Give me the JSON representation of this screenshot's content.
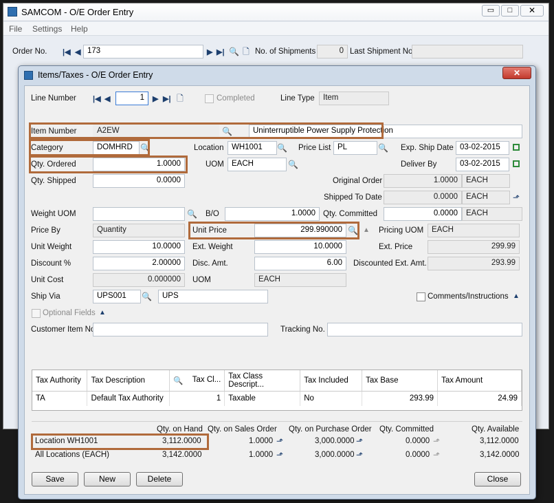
{
  "bg_window": {
    "title": "SAMCOM - O/E Order Entry",
    "menu": [
      "File",
      "Settings",
      "Help"
    ],
    "order_no_label": "Order No.",
    "order_no_value": "173",
    "shipments_label": "No. of Shipments",
    "shipments_value": "0",
    "last_shipment_label": "Last Shipment No."
  },
  "dialog": {
    "title": "Items/Taxes - O/E Order Entry",
    "line_number_label": "Line Number",
    "line_number_value": "1",
    "completed_label": "Completed",
    "line_type_label": "Line Type",
    "line_type_value": "Item",
    "item_number_label": "Item Number",
    "item_number_value": "A2EW",
    "item_description": "Uninterruptible Power Supply Protection",
    "category_label": "Category",
    "category_value": "DOMHRD",
    "location_label": "Location",
    "location_value": "WH1001",
    "price_list_label": "Price List",
    "price_list_value": "PL",
    "exp_ship_date_label": "Exp. Ship Date",
    "exp_ship_date_value": "03-02-2015",
    "qty_ordered_label": "Qty. Ordered",
    "qty_ordered_value": "1.0000",
    "uom_label": "UOM",
    "uom_value": "EACH",
    "deliver_by_label": "Deliver By",
    "deliver_by_value": "03-02-2015",
    "qty_shipped_label": "Qty. Shipped",
    "qty_shipped_value": "0.0000",
    "original_order_label": "Original Order",
    "original_order_value": "1.0000",
    "original_order_uom": "EACH",
    "shipped_to_date_label": "Shipped To Date",
    "shipped_to_date_value": "0.0000",
    "shipped_to_date_uom": "EACH",
    "weight_uom_label": "Weight UOM",
    "bo_label": "B/O",
    "bo_value": "1.0000",
    "qty_committed_label": "Qty. Committed",
    "qty_committed_value": "0.0000",
    "qty_committed_uom": "EACH",
    "price_by_label": "Price By",
    "price_by_value": "Quantity",
    "unit_price_label": "Unit Price",
    "unit_price_value": "299.990000",
    "pricing_uom_label": "Pricing UOM",
    "pricing_uom_value": "EACH",
    "unit_weight_label": "Unit Weight",
    "unit_weight_value": "10.0000",
    "ext_weight_label": "Ext. Weight",
    "ext_weight_value": "10.0000",
    "ext_price_label": "Ext. Price",
    "ext_price_value": "299.99",
    "discount_label": "Discount %",
    "discount_value": "2.00000",
    "disc_amt_label": "Disc. Amt.",
    "disc_amt_value": "6.00",
    "discounted_ext_label": "Discounted Ext. Amt.",
    "discounted_ext_value": "293.99",
    "unit_cost_label": "Unit Cost",
    "unit_cost_value": "0.000000",
    "uom2_label": "UOM",
    "uom2_value": "EACH",
    "ship_via_label": "Ship Via",
    "ship_via_code": "UPS001",
    "ship_via_name": "UPS",
    "comments_label": "Comments/Instructions",
    "optional_fields_label": "Optional Fields",
    "customer_item_label": "Customer Item No.",
    "tracking_label": "Tracking No."
  },
  "tax_table": {
    "headers": [
      "Tax Authority",
      "Tax Description",
      "Tax Cl...",
      "Tax Class Descript...",
      "Tax Included",
      "Tax Base",
      "Tax Amount"
    ],
    "row": [
      "TA",
      "Default Tax Authority",
      "1",
      "Taxable",
      "No",
      "293.99",
      "24.99"
    ]
  },
  "qty_table": {
    "headers": [
      "Qty. on Hand",
      "Qty. on Sales Order",
      "Qty. on Purchase Order",
      "Qty. Committed",
      "Qty. Available"
    ],
    "row1": {
      "label": "Location   WH1001",
      "on_hand": "3,112.0000",
      "sales": "1.0000",
      "purchase": "3,000.0000",
      "committed": "0.0000",
      "available": "3,112.0000"
    },
    "row2": {
      "label": "All Locations (EACH)",
      "on_hand": "3,142.0000",
      "sales": "1.0000",
      "purchase": "3,000.0000",
      "committed": "0.0000",
      "available": "3,142.0000"
    }
  },
  "buttons": {
    "save": "Save",
    "new": "New",
    "delete": "Delete",
    "close": "Close"
  },
  "colors": {
    "highlight": "#b06a3b",
    "close_button": "#c9463b",
    "title_bar": "#cfdbe9"
  }
}
